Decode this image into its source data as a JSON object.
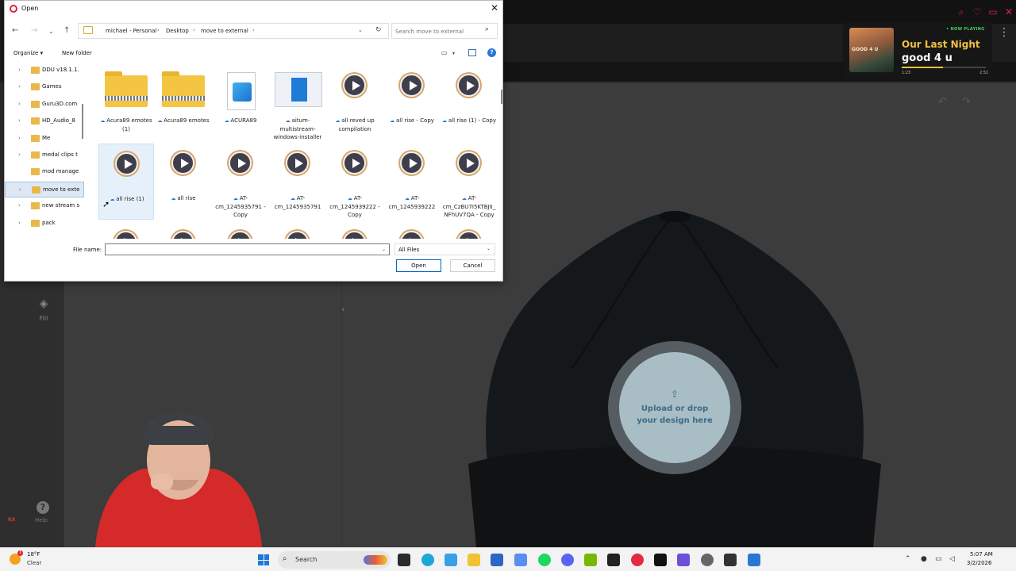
{
  "dialog": {
    "title": "Open",
    "breadcrumb": [
      "michael - Personal",
      "Desktop",
      "move to external"
    ],
    "search_placeholder": "Search move to external",
    "toolbar": {
      "organize": "Organize",
      "new_folder": "New folder"
    },
    "nav_tree": [
      {
        "label": "DDU v18.1.1.",
        "selected": false,
        "expandable": true
      },
      {
        "label": "Games",
        "selected": false,
        "expandable": true
      },
      {
        "label": "Guru3D.com",
        "selected": false,
        "expandable": true
      },
      {
        "label": "HD_Audio_8",
        "selected": false,
        "expandable": true
      },
      {
        "label": "Me",
        "selected": false,
        "expandable": true
      },
      {
        "label": "medal clips t",
        "selected": false,
        "expandable": true
      },
      {
        "label": "mod manage",
        "selected": false,
        "expandable": false
      },
      {
        "label": "move to exte",
        "selected": true,
        "expandable": true
      },
      {
        "label": "new stream s",
        "selected": false,
        "expandable": true
      },
      {
        "label": "pack",
        "selected": false,
        "expandable": true
      }
    ],
    "files": [
      {
        "name": "Acura89 emotes (1)",
        "kind": "zip",
        "selected": false
      },
      {
        "name": "Acura89 emotes",
        "kind": "zip",
        "selected": false
      },
      {
        "name": "ACURA89",
        "kind": "image",
        "selected": false
      },
      {
        "name": "aitum-multistream-windows-installer",
        "kind": "installer",
        "selected": false
      },
      {
        "name": "all reved up compilation",
        "kind": "video",
        "selected": false
      },
      {
        "name": "all rise - Copy",
        "kind": "video",
        "selected": false
      },
      {
        "name": "all rise (1) - Copy",
        "kind": "video",
        "selected": false
      },
      {
        "name": "all rise (1)",
        "kind": "video",
        "selected": true
      },
      {
        "name": "all rise",
        "kind": "video",
        "selected": false
      },
      {
        "name": "AT-cm_1245935791 - Copy",
        "kind": "video",
        "selected": false
      },
      {
        "name": "AT-cm_1245935791",
        "kind": "video",
        "selected": false
      },
      {
        "name": "AT-cm_1245939222 - Copy",
        "kind": "video",
        "selected": false
      },
      {
        "name": "AT-cm_1245939222",
        "kind": "video",
        "selected": false
      },
      {
        "name": "AT-cm_CzBU7I5KTBJII_NFhUV7QA - Copy",
        "kind": "video",
        "selected": false
      }
    ],
    "file_name_label": "File name:",
    "file_name_value": "",
    "file_type": "All Files",
    "open_label": "Open",
    "cancel_label": "Cancel"
  },
  "background_app": {
    "fill_label": "Fill",
    "help_label": "Help",
    "upload_text_1": "Upload or drop",
    "upload_text_2": "your design here",
    "upload_icon": "upload-icon",
    "cap_color": "#111417"
  },
  "now_playing": {
    "badge": "• NOW PLAYING",
    "art_text": "GOOD 4 U",
    "title": "Our Last Night",
    "artist": "good 4 u",
    "elapsed": "1:23",
    "total": "2:51",
    "progress": 0.49,
    "accent": "#f0c040"
  },
  "webcam": {
    "label": "RX"
  },
  "taskbar": {
    "weather_badge": "1",
    "temp": "18°F",
    "condition": "Clear",
    "search_label": "Search",
    "time": "5:07 AM",
    "date": "3/2/2026"
  }
}
